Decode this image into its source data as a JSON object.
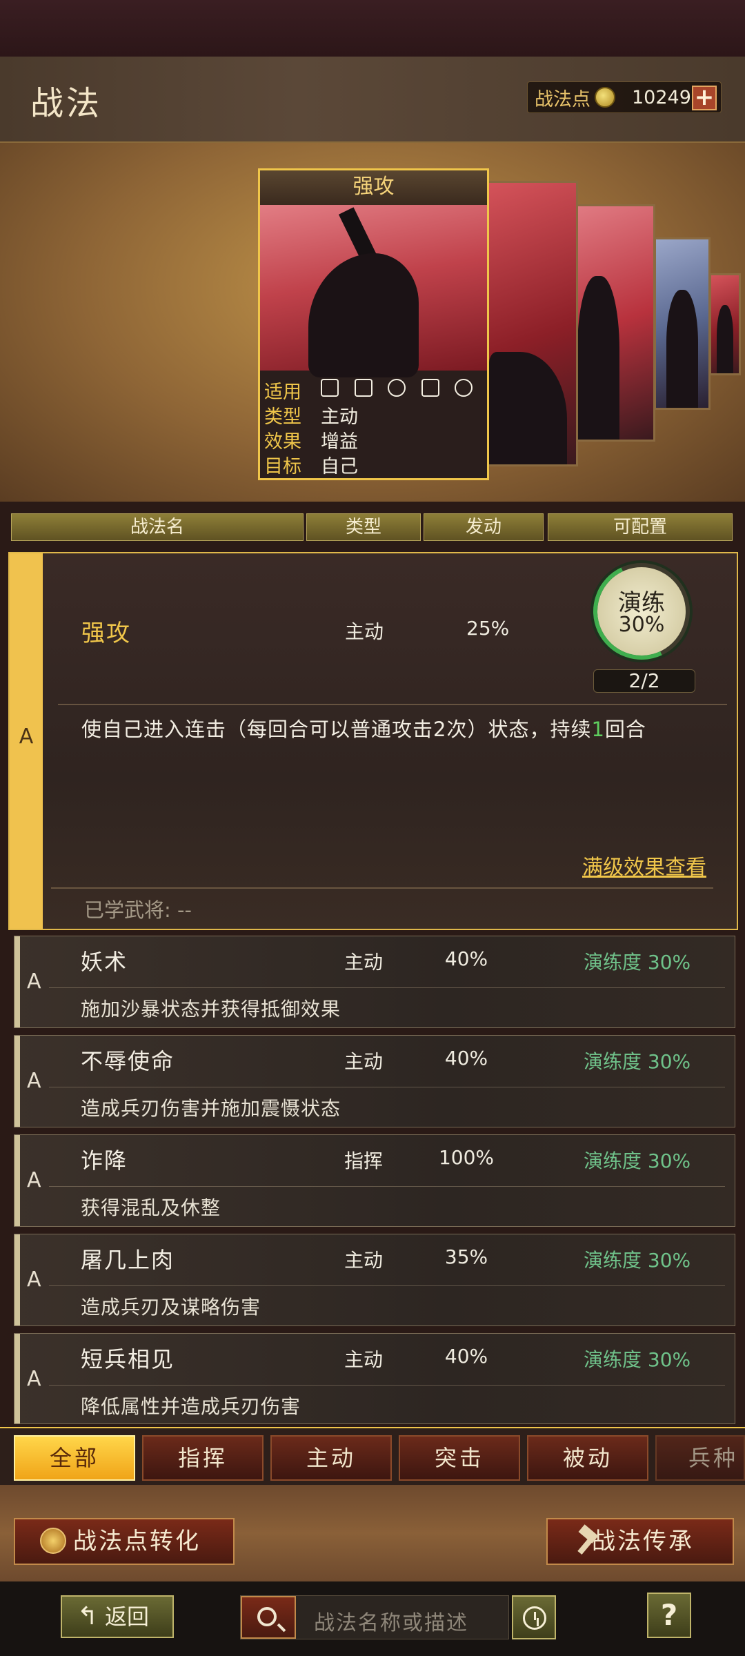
{
  "header": {
    "title": "战法",
    "points_label": "战法点",
    "points_value": "10249"
  },
  "showcase": {
    "card_name": "强攻",
    "rows": [
      {
        "key": "适用",
        "value": ""
      },
      {
        "key": "类型",
        "value": "主动"
      },
      {
        "key": "效果",
        "value": "增益"
      },
      {
        "key": "目标",
        "value": "自己"
      }
    ],
    "troop_icons": [
      "cavalry-icon",
      "shield-icon",
      "bow-icon",
      "spear-icon",
      "wheel-icon"
    ]
  },
  "table_header": {
    "col_name": "战法名",
    "col_type": "类型",
    "col_rate": "发动",
    "col_config": "可配置"
  },
  "selected": {
    "rank": "A",
    "name": "强攻",
    "type": "主动",
    "rate": "25%",
    "drill_label": "演练",
    "drill_value": "30%",
    "drill_progress": 0.3,
    "count": "2/2",
    "desc_before": "使自己进入连击（每回合可以普通攻击2次）状态，持续",
    "desc_highlight": "1",
    "desc_after": "回合",
    "max_effect_link": "满级效果查看",
    "learned": "已学武将: --"
  },
  "skills": [
    {
      "rank": "A",
      "name": "妖术",
      "type": "主动",
      "rate": "40%",
      "drill": "演练度 30%",
      "desc": "施加沙暴状态并获得抵御效果"
    },
    {
      "rank": "A",
      "name": "不辱使命",
      "type": "主动",
      "rate": "40%",
      "drill": "演练度 30%",
      "desc": "造成兵刃伤害并施加震慑状态"
    },
    {
      "rank": "A",
      "name": "诈降",
      "type": "指挥",
      "rate": "100%",
      "drill": "演练度 30%",
      "desc": "获得混乱及休整"
    },
    {
      "rank": "A",
      "name": "屠几上肉",
      "type": "主动",
      "rate": "35%",
      "drill": "演练度 30%",
      "desc": "造成兵刃及谋略伤害"
    },
    {
      "rank": "A",
      "name": "短兵相见",
      "type": "主动",
      "rate": "40%",
      "drill": "演练度 30%",
      "desc": "降低属性并造成兵刃伤害"
    }
  ],
  "tabs": [
    "全部",
    "指挥",
    "主动",
    "突击",
    "被动",
    "兵种"
  ],
  "bottom": {
    "convert_label": "战法点转化",
    "inherit_label": "战法传承"
  },
  "nav": {
    "back_label": "返回",
    "search_placeholder": "战法名称或描述",
    "help_label": "?"
  }
}
